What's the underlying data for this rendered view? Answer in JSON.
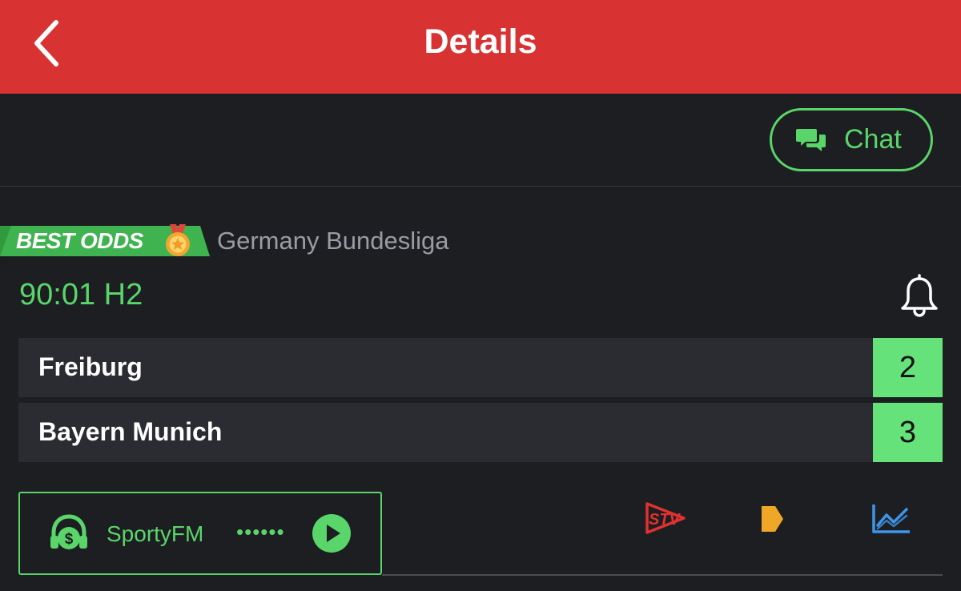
{
  "header": {
    "title": "Details",
    "back_icon": "chevron-left-icon",
    "background": "#d83233"
  },
  "chat": {
    "label": "Chat",
    "icon": "chat-bubbles-icon"
  },
  "match": {
    "badge": "BEST ODDS",
    "badge_icon": "medal-icon",
    "league": "Germany Bundesliga",
    "time": "90:01 H2",
    "notify_icon": "bell-icon",
    "teams": [
      {
        "name": "Freiburg",
        "score": "2"
      },
      {
        "name": "Bayern Munich",
        "score": "3"
      }
    ]
  },
  "radio": {
    "label": "SportyFM",
    "dots": "••••••",
    "icon": "sportyfm-headphones-icon",
    "play_icon": "play-icon"
  },
  "actions": [
    {
      "icon": "sportytv-icon",
      "label": "STV"
    },
    {
      "icon": "live-tracker-icon"
    },
    {
      "icon": "stats-chart-icon"
    }
  ],
  "colors": {
    "accent_green": "#5ad56a",
    "score_green": "#66e27b",
    "brand_red": "#d83233",
    "tv_red": "#e0312f",
    "tracker_orange": "#f0a727",
    "stats_blue": "#3e95e8"
  }
}
